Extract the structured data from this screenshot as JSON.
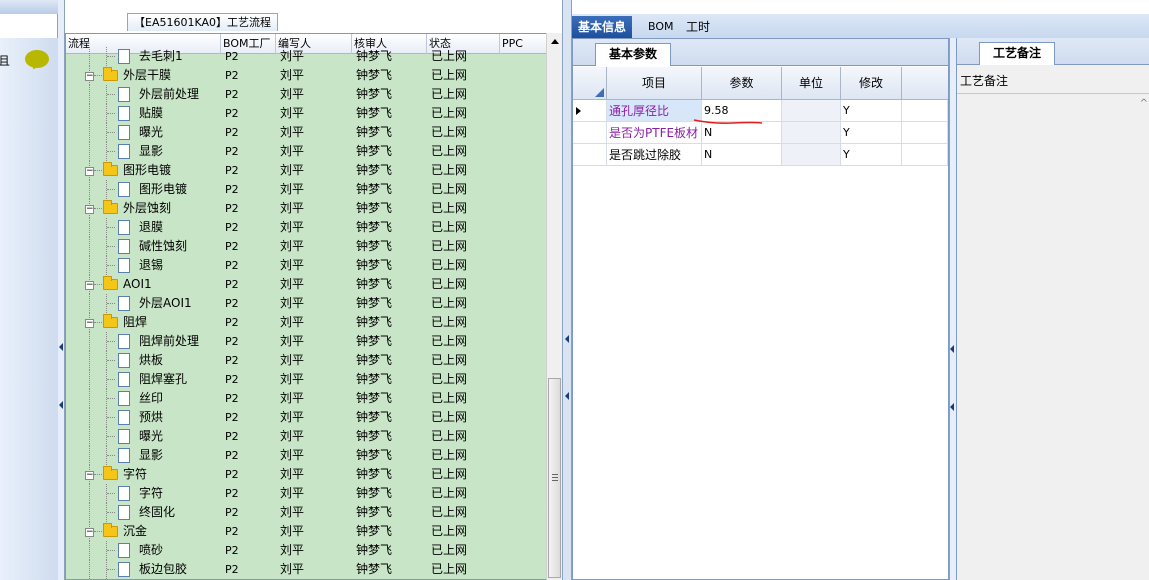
{
  "left_strip": {
    "label": "且"
  },
  "process_panel": {
    "title": "【EA51601KA0】工艺流程",
    "columns": [
      "流程",
      "BOM工厂",
      "编写人",
      "核审人",
      "状态",
      "PPC"
    ],
    "rows": [
      {
        "level": 2,
        "type": "doc",
        "name": "去毛刺1",
        "bom": "P2",
        "writer": "刘平",
        "reviewer": "钟梦飞",
        "status": "已上网"
      },
      {
        "level": 1,
        "type": "folder",
        "name": "外层干膜",
        "bom": "P2",
        "writer": "刘平",
        "reviewer": "钟梦飞",
        "status": "已上网"
      },
      {
        "level": 2,
        "type": "doc",
        "name": "外层前处理",
        "bom": "P2",
        "writer": "刘平",
        "reviewer": "钟梦飞",
        "status": "已上网"
      },
      {
        "level": 2,
        "type": "doc",
        "name": "贴膜",
        "bom": "P2",
        "writer": "刘平",
        "reviewer": "钟梦飞",
        "status": "已上网"
      },
      {
        "level": 2,
        "type": "doc",
        "name": "曝光",
        "bom": "P2",
        "writer": "刘平",
        "reviewer": "钟梦飞",
        "status": "已上网"
      },
      {
        "level": 2,
        "type": "doc",
        "name": "显影",
        "bom": "P2",
        "writer": "刘平",
        "reviewer": "钟梦飞",
        "status": "已上网"
      },
      {
        "level": 1,
        "type": "folder",
        "name": "图形电镀",
        "bom": "P2",
        "writer": "刘平",
        "reviewer": "钟梦飞",
        "status": "已上网"
      },
      {
        "level": 2,
        "type": "doc",
        "name": "图形电镀",
        "bom": "P2",
        "writer": "刘平",
        "reviewer": "钟梦飞",
        "status": "已上网"
      },
      {
        "level": 1,
        "type": "folder",
        "name": "外层蚀刻",
        "bom": "P2",
        "writer": "刘平",
        "reviewer": "钟梦飞",
        "status": "已上网"
      },
      {
        "level": 2,
        "type": "doc",
        "name": "退膜",
        "bom": "P2",
        "writer": "刘平",
        "reviewer": "钟梦飞",
        "status": "已上网"
      },
      {
        "level": 2,
        "type": "doc",
        "name": "碱性蚀刻",
        "bom": "P2",
        "writer": "刘平",
        "reviewer": "钟梦飞",
        "status": "已上网"
      },
      {
        "level": 2,
        "type": "doc",
        "name": "退锡",
        "bom": "P2",
        "writer": "刘平",
        "reviewer": "钟梦飞",
        "status": "已上网"
      },
      {
        "level": 1,
        "type": "folder",
        "name": "AOI1",
        "bom": "P2",
        "writer": "刘平",
        "reviewer": "钟梦飞",
        "status": "已上网"
      },
      {
        "level": 2,
        "type": "doc",
        "name": "外层AOI1",
        "bom": "P2",
        "writer": "刘平",
        "reviewer": "钟梦飞",
        "status": "已上网"
      },
      {
        "level": 1,
        "type": "folder",
        "name": "阻焊",
        "bom": "P2",
        "writer": "刘平",
        "reviewer": "钟梦飞",
        "status": "已上网"
      },
      {
        "level": 2,
        "type": "doc",
        "name": "阻焊前处理",
        "bom": "P2",
        "writer": "刘平",
        "reviewer": "钟梦飞",
        "status": "已上网"
      },
      {
        "level": 2,
        "type": "doc",
        "name": "烘板",
        "bom": "P2",
        "writer": "刘平",
        "reviewer": "钟梦飞",
        "status": "已上网"
      },
      {
        "level": 2,
        "type": "doc",
        "name": "阻焊塞孔",
        "bom": "P2",
        "writer": "刘平",
        "reviewer": "钟梦飞",
        "status": "已上网"
      },
      {
        "level": 2,
        "type": "doc",
        "name": "丝印",
        "bom": "P2",
        "writer": "刘平",
        "reviewer": "钟梦飞",
        "status": "已上网"
      },
      {
        "level": 2,
        "type": "doc",
        "name": "预烘",
        "bom": "P2",
        "writer": "刘平",
        "reviewer": "钟梦飞",
        "status": "已上网"
      },
      {
        "level": 2,
        "type": "doc",
        "name": "曝光",
        "bom": "P2",
        "writer": "刘平",
        "reviewer": "钟梦飞",
        "status": "已上网"
      },
      {
        "level": 2,
        "type": "doc",
        "name": "显影",
        "bom": "P2",
        "writer": "刘平",
        "reviewer": "钟梦飞",
        "status": "已上网"
      },
      {
        "level": 1,
        "type": "folder",
        "name": "字符",
        "bom": "P2",
        "writer": "刘平",
        "reviewer": "钟梦飞",
        "status": "已上网"
      },
      {
        "level": 2,
        "type": "doc",
        "name": "字符",
        "bom": "P2",
        "writer": "刘平",
        "reviewer": "钟梦飞",
        "status": "已上网"
      },
      {
        "level": 2,
        "type": "doc",
        "name": "终固化",
        "bom": "P2",
        "writer": "刘平",
        "reviewer": "钟梦飞",
        "status": "已上网"
      },
      {
        "level": 1,
        "type": "folder",
        "name": "沉金",
        "bom": "P2",
        "writer": "刘平",
        "reviewer": "钟梦飞",
        "status": "已上网"
      },
      {
        "level": 2,
        "type": "doc",
        "name": "喷砂",
        "bom": "P2",
        "writer": "刘平",
        "reviewer": "钟梦飞",
        "status": "已上网"
      },
      {
        "level": 2,
        "type": "doc",
        "name": "板边包胶",
        "bom": "P2",
        "writer": "刘平",
        "reviewer": "钟梦飞",
        "status": "已上网"
      }
    ]
  },
  "tabs": [
    "基本信息",
    "BOM",
    "工时"
  ],
  "params_panel": {
    "tab": "基本参数",
    "columns": [
      "项目",
      "参数",
      "单位",
      "修改"
    ],
    "rows": [
      {
        "item": "通孔厚径比",
        "value": "9.58",
        "unit": "",
        "modify": "Y",
        "purple": true,
        "selected": true
      },
      {
        "item": "是否为PTFE板材",
        "value": "N",
        "unit": "",
        "modify": "Y",
        "purple": true,
        "selected": false
      },
      {
        "item": "是否跳过除胶",
        "value": "N",
        "unit": "",
        "modify": "Y",
        "purple": false,
        "selected": false
      }
    ]
  },
  "notes_panel": {
    "tab": "工艺备注",
    "label": "工艺备注"
  },
  "colors": {
    "tree_bg": "#c9e5c7",
    "purple_text": "#8a1fa6",
    "active_tab": "#1d4f9e",
    "annotation_red": "#e02020"
  }
}
